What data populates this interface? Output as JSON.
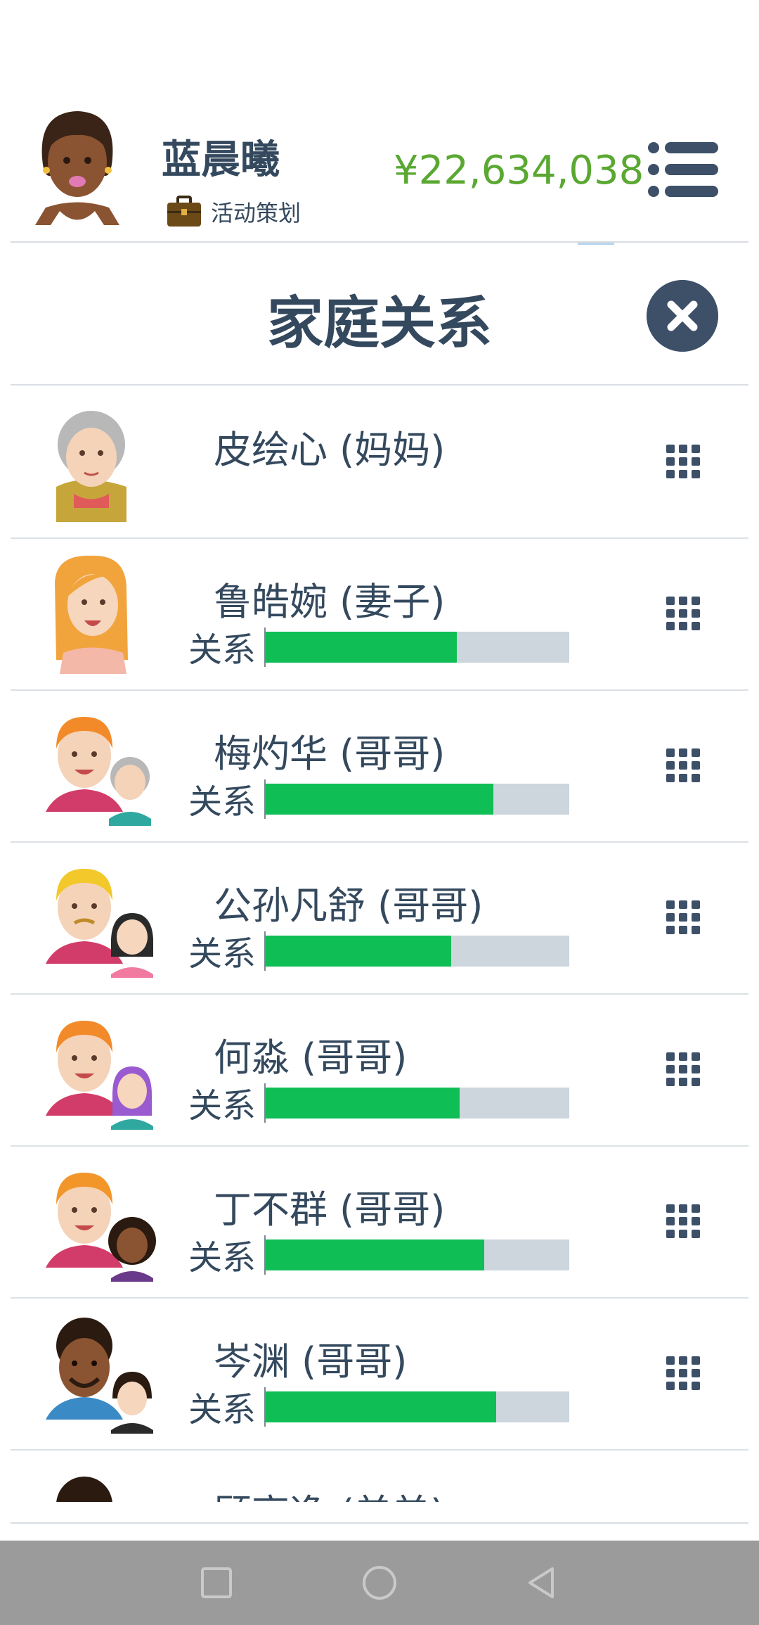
{
  "header": {
    "user_name": "蓝晨曦",
    "job": "活动策划",
    "money": "¥22,634,038"
  },
  "dialog": {
    "title": "家庭关系"
  },
  "relation_label": "关系",
  "members": [
    {
      "name": "皮绘心 (妈妈)",
      "relationship": null
    },
    {
      "name": "鲁皓婉 (妻子)",
      "relationship": 0.63
    },
    {
      "name": "梅灼华 (哥哥)",
      "relationship": 0.75
    },
    {
      "name": "公孙凡舒 (哥哥)",
      "relationship": 0.61
    },
    {
      "name": "何淼 (哥哥)",
      "relationship": 0.64
    },
    {
      "name": "丁不群 (哥哥)",
      "relationship": 0.72
    },
    {
      "name": "岑渊 (哥哥)",
      "relationship": 0.76
    },
    {
      "name": "顾高逸 (弟弟)",
      "relationship": null
    }
  ],
  "colors": {
    "accent_text": "#34495e",
    "money": "#5aa832",
    "bar_fill": "#0fbe55",
    "bar_track": "#cdd5dd"
  }
}
